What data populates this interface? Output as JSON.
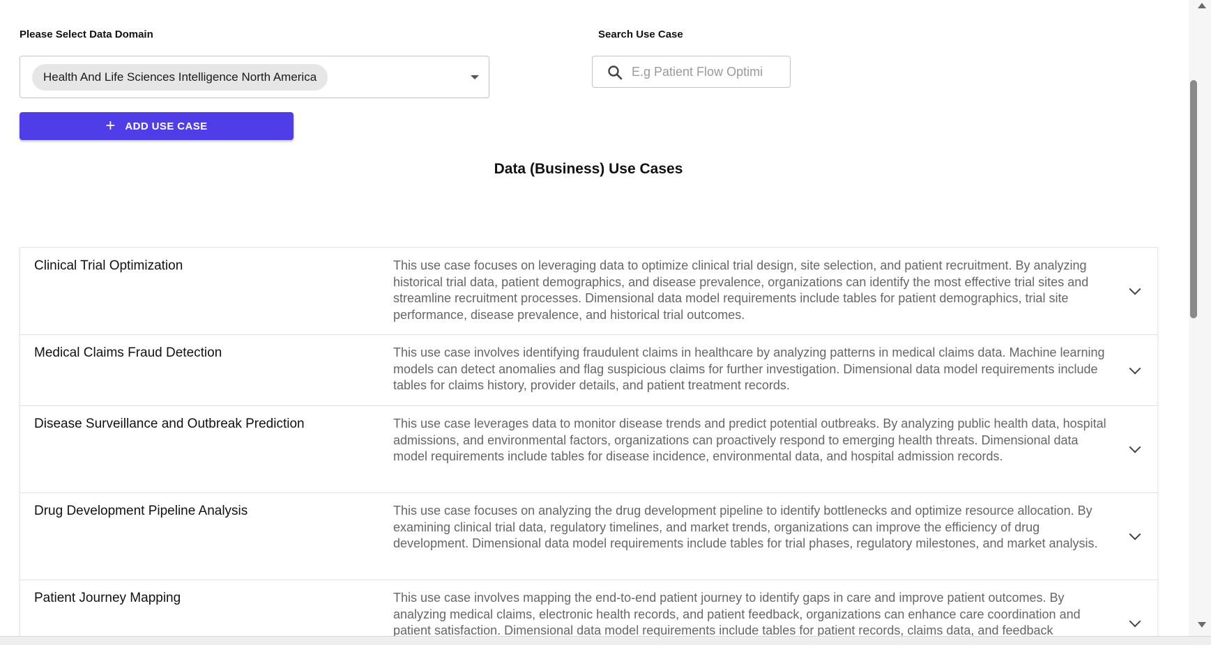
{
  "filters": {
    "domain_label": "Please Select Data Domain",
    "domain_selected": "Health And Life Sciences Intelligence North America",
    "search_label": "Search Use Case",
    "search_placeholder": "E.g Patient Flow Optimi",
    "search_value": ""
  },
  "actions": {
    "add_button_icon": "plus-icon",
    "add_button_label": "ADD USE CASE",
    "accent_color": "#4f3ee8"
  },
  "section": {
    "title": "Data (Business) Use Cases"
  },
  "use_cases": [
    {
      "title": "Clinical Trial Optimization",
      "description": "This use case focuses on leveraging data to optimize clinical trial design, site selection, and patient recruitment. By analyzing historical trial data, patient demographics, and disease prevalence, organizations can identify the most effective trial sites and streamline recruitment processes. Dimensional data model requirements include tables for patient demographics, trial site performance, disease prevalence, and historical trial outcomes."
    },
    {
      "title": "Medical Claims Fraud Detection",
      "description": "This use case involves identifying fraudulent claims in healthcare by analyzing patterns in medical claims data. Machine learning models can detect anomalies and flag suspicious claims for further investigation. Dimensional data model requirements include tables for claims history, provider details, and patient treatment records."
    },
    {
      "title": "Disease Surveillance and Outbreak Prediction",
      "description": "This use case leverages data to monitor disease trends and predict potential outbreaks. By analyzing public health data, hospital admissions, and environmental factors, organizations can proactively respond to emerging health threats. Dimensional data model requirements include tables for disease incidence, environmental data, and hospital admission records."
    },
    {
      "title": "Drug Development Pipeline Analysis",
      "description": "This use case focuses on analyzing the drug development pipeline to identify bottlenecks and optimize resource allocation. By examining clinical trial data, regulatory timelines, and market trends, organizations can improve the efficiency of drug development. Dimensional data model requirements include tables for trial phases, regulatory milestones, and market analysis."
    },
    {
      "title": "Patient Journey Mapping",
      "description": "This use case involves mapping the end-to-end patient journey to identify gaps in care and improve patient outcomes. By analyzing medical claims, electronic health records, and patient feedback, organizations can enhance care coordination and patient satisfaction. Dimensional data model requirements include tables for patient records, claims data, and feedback"
    }
  ]
}
